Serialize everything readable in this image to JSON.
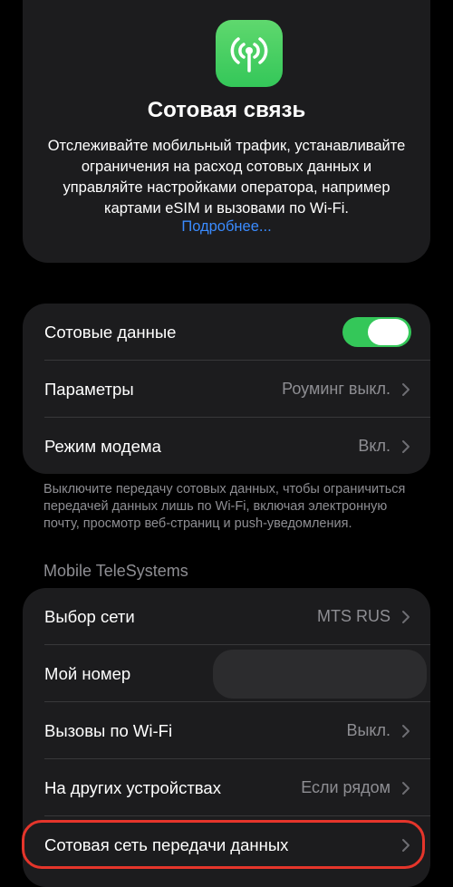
{
  "header": {
    "icon": "antenna-icon",
    "title": "Сотовая связь",
    "description": "Отслеживайте мобильный трафик, устанавливайте ограничения на расход сотовых данных и управляйте настройками оператора, например картами eSIM и вызовами по Wi-Fi.",
    "more_link": "Подробнее..."
  },
  "main_group": {
    "cellular_data": {
      "label": "Сотовые данные",
      "enabled": true
    },
    "options": {
      "label": "Параметры",
      "value": "Роуминг выкл."
    },
    "hotspot": {
      "label": "Режим модема",
      "value": "Вкл."
    }
  },
  "footer_note": "Выключите передачу сотовых данных, чтобы ограничиться передачей данных лишь по Wi-Fi, включая электронную почту, просмотр веб-страниц и push-уведомления.",
  "carrier": {
    "section_title": "Mobile TeleSystems",
    "network_selection": {
      "label": "Выбор сети",
      "value": "MTS RUS"
    },
    "my_number": {
      "label": "Мой номер",
      "value": ""
    },
    "wifi_calling": {
      "label": "Вызовы по Wi-Fi",
      "value": "Выкл."
    },
    "other_devices": {
      "label": "На других устройствах",
      "value": "Если рядом"
    },
    "cellular_data_network": {
      "label": "Сотовая сеть передачи данных",
      "highlighted": true
    }
  },
  "colors": {
    "background": "#000000",
    "card": "#1c1c1e",
    "accent_green": "#34c759",
    "link_blue": "#3a8bff",
    "secondary_text": "#8e8e93",
    "highlight_red": "#e5352b"
  }
}
